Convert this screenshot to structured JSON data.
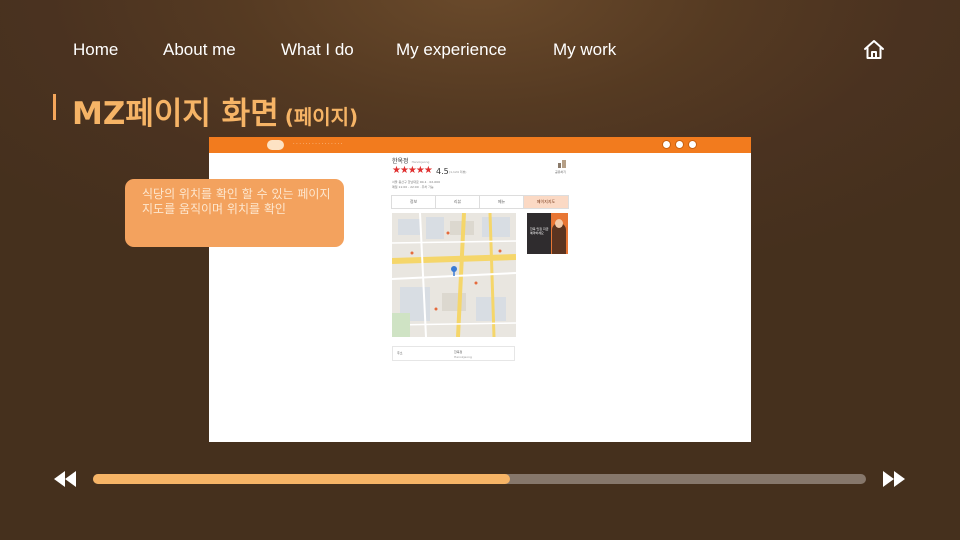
{
  "nav": {
    "items": [
      {
        "label": "Home"
      },
      {
        "label": "About me"
      },
      {
        "label": "What I do"
      },
      {
        "label": "My experience"
      },
      {
        "label": "My work"
      }
    ],
    "home_icon": "home-icon"
  },
  "header": {
    "title": "MZ페이지 화면",
    "subtitle": "(페이지)"
  },
  "screenshot": {
    "restaurant_name": "한옥정",
    "restaurant_sub": "Hanokjeong",
    "rating": "4.5",
    "rating_sub": "(1,124 리뷰)",
    "share_label": "공유하기",
    "info_lines": [
      "서울 용산구 한남대로 00-1 · 02-000",
      "매일 11:00 - 22:00 · 주차 가능"
    ],
    "tabs": [
      "정보",
      "리뷰",
      "메뉴",
      "페이지지도"
    ],
    "footer_label": "주소",
    "footer_value": "한옥정",
    "footer_value2": "Hanokjeong",
    "ad_text": "한옥 맛집 지금 예약하세요"
  },
  "callout": {
    "text": "식당의 위치를 확인 할 수 있는 페이지 지도를 움직이며 위치를 확인"
  },
  "progress": {
    "value": 0.54
  },
  "controls": {
    "prev_icon": "rewind-icon",
    "next_icon": "fast-forward-icon"
  },
  "colors": {
    "background": "#4a3220",
    "accent": "#f6b466",
    "callout": "#f3a25e",
    "screenshot_header": "#f27b1e",
    "progress_track": "#86776b"
  }
}
